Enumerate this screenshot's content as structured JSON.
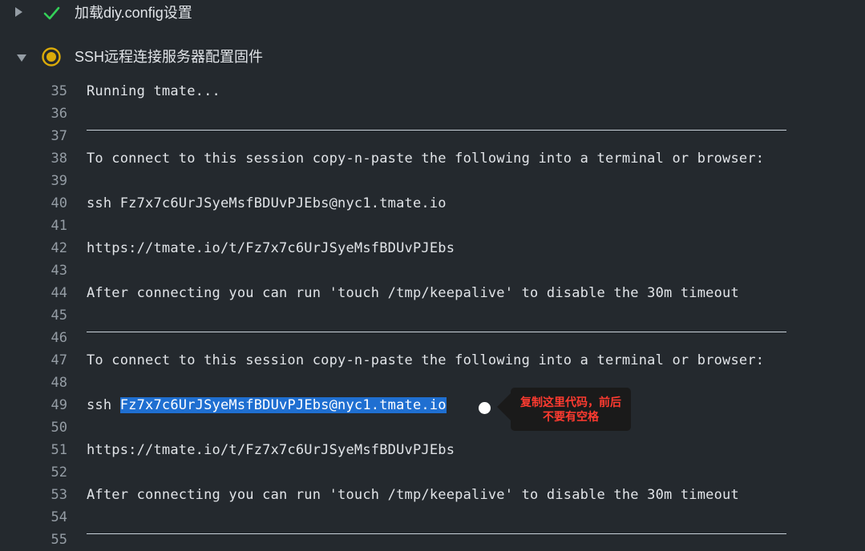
{
  "steps": [
    {
      "title": "加载diy.config设置",
      "status": "success",
      "expanded": false
    },
    {
      "title": "SSH远程连接服务器配置固件",
      "status": "in-progress",
      "expanded": true
    }
  ],
  "log_lines": [
    {
      "num": "35",
      "text": "Running tmate..."
    },
    {
      "num": "36",
      "text": ""
    },
    {
      "num": "37",
      "text": "",
      "rule": true
    },
    {
      "num": "38",
      "text": "To connect to this session copy-n-paste the following into a terminal or browser:"
    },
    {
      "num": "39",
      "text": ""
    },
    {
      "num": "40",
      "text": "ssh Fz7x7c6UrJSyeMsfBDUvPJEbs@nyc1.tmate.io"
    },
    {
      "num": "41",
      "text": ""
    },
    {
      "num": "42",
      "text": "https://tmate.io/t/Fz7x7c6UrJSyeMsfBDUvPJEbs"
    },
    {
      "num": "43",
      "text": ""
    },
    {
      "num": "44",
      "text": "After connecting you can run 'touch /tmp/keepalive' to disable the 30m timeout"
    },
    {
      "num": "45",
      "text": ""
    },
    {
      "num": "46",
      "text": "",
      "rule": true
    },
    {
      "num": "47",
      "text": "To connect to this session copy-n-paste the following into a terminal or browser:"
    },
    {
      "num": "48",
      "text": ""
    },
    {
      "num": "49",
      "text": "ssh ",
      "highlight": "Fz7x7c6UrJSyeMsfBDUvPJEbs@nyc1.tmate.io"
    },
    {
      "num": "50",
      "text": ""
    },
    {
      "num": "51",
      "text": "https://tmate.io/t/Fz7x7c6UrJSyeMsfBDUvPJEbs"
    },
    {
      "num": "52",
      "text": ""
    },
    {
      "num": "53",
      "text": "After connecting you can run 'touch /tmp/keepalive' to disable the 30m timeout"
    },
    {
      "num": "54",
      "text": ""
    },
    {
      "num": "55",
      "text": "",
      "rule": true
    }
  ],
  "annotation": {
    "text": "复制这里代码，前后不要有空格"
  },
  "colors": {
    "background": "#24292e",
    "success": "#34d058",
    "in_progress": "#dbab09",
    "highlight": "#1f6fd1",
    "annotation_text": "#ff3b30"
  },
  "icons": {
    "step1_status": "check-icon",
    "step2_status": "in-progress-icon",
    "collapsed": "caret-right-icon",
    "expanded": "caret-down-icon"
  }
}
